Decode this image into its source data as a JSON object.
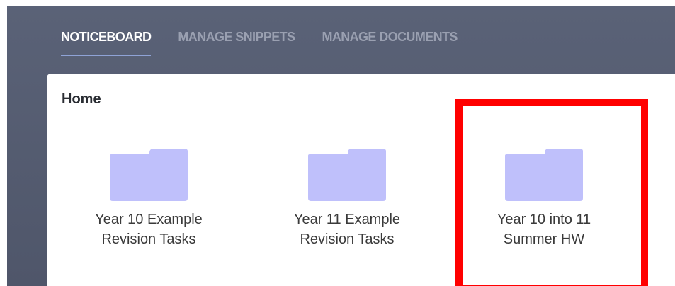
{
  "nav": {
    "tabs": [
      {
        "label": "NOTICEBOARD",
        "active": true
      },
      {
        "label": "MANAGE SNIPPETS",
        "active": false
      },
      {
        "label": "MANAGE DOCUMENTS",
        "active": false
      }
    ]
  },
  "breadcrumb": "Home",
  "folders": [
    {
      "line1": "Year 10 Example",
      "line2": "Revision Tasks",
      "icon": "folder-icon"
    },
    {
      "line1": "Year 11 Example",
      "line2": "Revision Tasks",
      "icon": "folder-icon"
    },
    {
      "line1": "Year 10 into 11",
      "line2": "Summer HW",
      "icon": "folder-icon"
    }
  ],
  "colors": {
    "header_bg": "#555c70",
    "folder": "#bfc0fb",
    "highlight": "#ff0000",
    "tab_active": "#ffffff",
    "tab_inactive": "#9aa0b1"
  }
}
